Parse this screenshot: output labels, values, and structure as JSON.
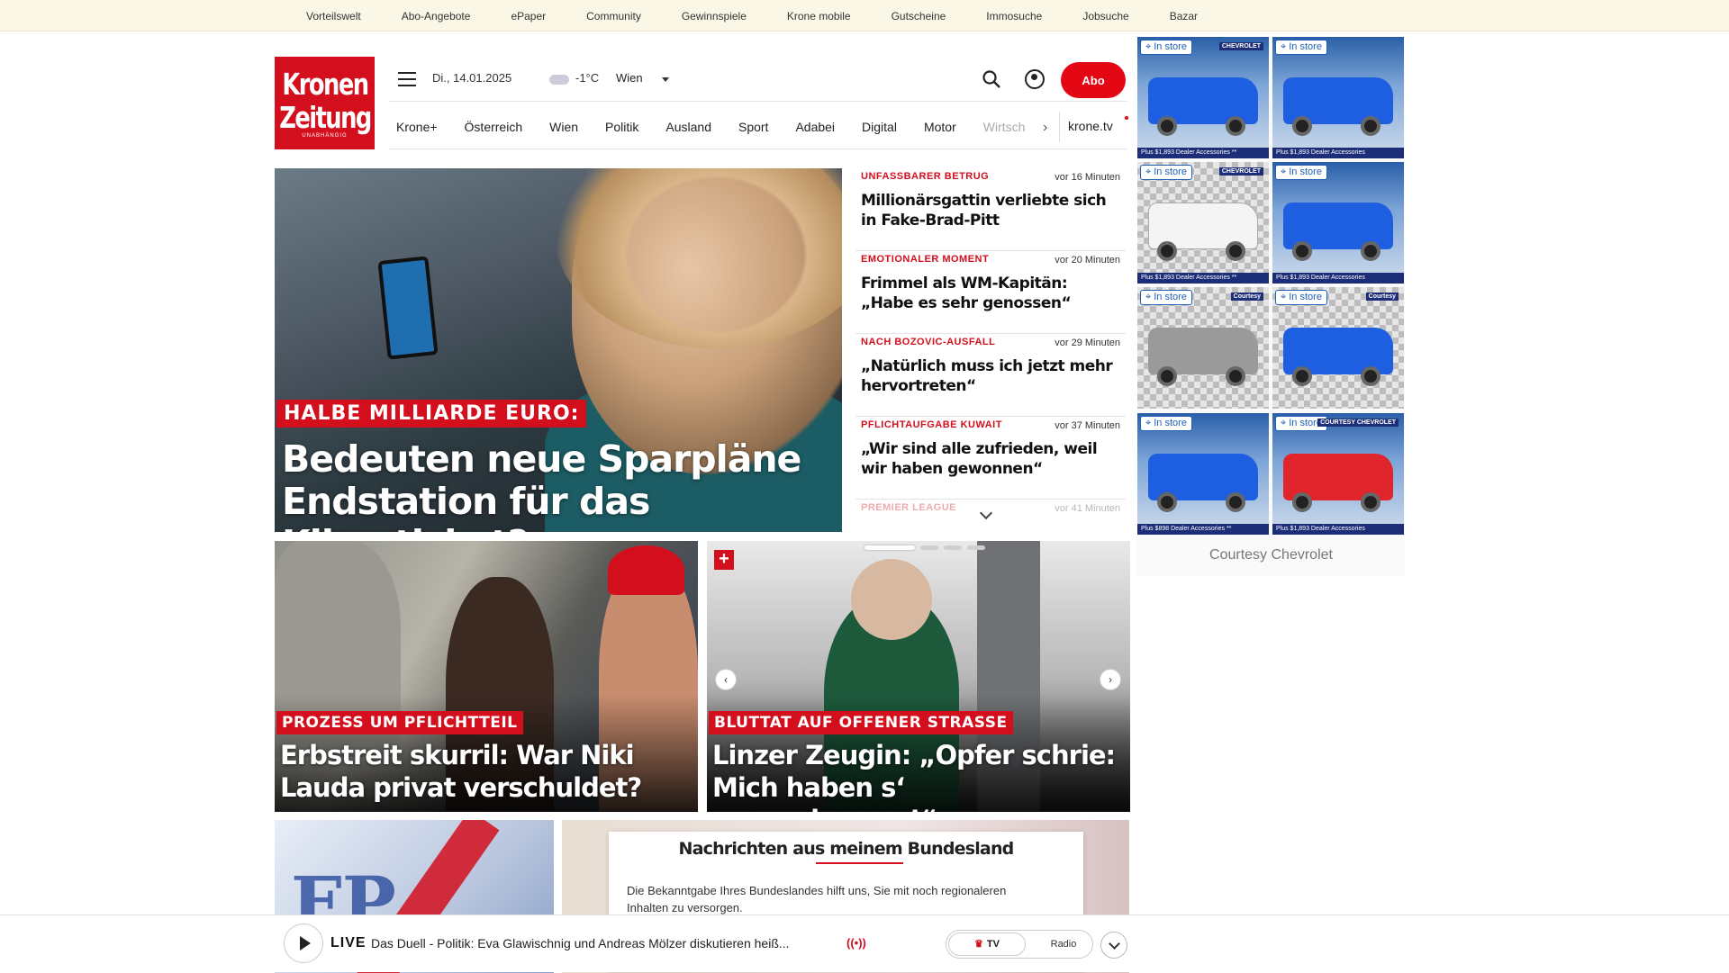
{
  "topbar": {
    "links": [
      "Vorteilswelt",
      "Abo-Angebote",
      "ePaper",
      "Community",
      "Gewinnspiele",
      "Krone mobile",
      "Gutscheine",
      "Immosuche",
      "Jobsuche",
      "Bazar"
    ]
  },
  "logo": {
    "line1": "Kronen",
    "line2": "Zeitung",
    "tagline": "UNABHÄNGIG"
  },
  "header": {
    "date": "Di., 14.01.2025",
    "weather_icon": "cloud-icon",
    "temperature": "-1°C",
    "city": "Wien",
    "abo_label": "Abo"
  },
  "nav": {
    "items": [
      "Krone+",
      "Österreich",
      "Wien",
      "Politik",
      "Ausland",
      "Sport",
      "Adabei",
      "Digital",
      "Motor",
      "Wirtsch"
    ],
    "krone_tv": "krone.tv"
  },
  "hero": {
    "kicker": "HALBE MILLIARDE EURO:",
    "headline": "Bedeuten neue Sparpläne Endstation für das Klimaticket?"
  },
  "ticker": [
    {
      "kicker": "UNFASSBARER BETRUG",
      "time": "vor 16 Minuten",
      "title": "Millionärsgattin verliebte sich in Fake-Brad-Pitt"
    },
    {
      "kicker": "EMOTIONALER MOMENT",
      "time": "vor 20 Minuten",
      "title": "Frimmel als WM-Kapitän: „Habe es sehr genossen“"
    },
    {
      "kicker": "NACH BOZOVIC-AUSFALL",
      "time": "vor 29 Minuten",
      "title": "„Natürlich muss ich jetzt mehr hervortreten“"
    },
    {
      "kicker": "PFLICHTAUFGABE KUWAIT",
      "time": "vor 37 Minuten",
      "title": "„Wir sind alle zufrieden, weil wir haben gewonnen“"
    },
    {
      "kicker": "PREMIER LEAGUE",
      "time": "vor 41 Minuten",
      "title": ""
    }
  ],
  "cards": [
    {
      "kicker": "PROZESS UM PFLICHTTEIL",
      "headline": "Erbstreit skurril: War Niki Lauda privat verschuldet?"
    },
    {
      "kicker": "BLUTTAT AUF OFFENER STRASSE",
      "headline": "Linzer Zeugin: „Opfer schrie: Mich haben s‘ angeschossen!“"
    }
  ],
  "bundesland": {
    "title": "Nachrichten aus meinem Bundesland",
    "description": "Die Bekanntgabe Ihres Bundeslandes hilft uns, Sie mit noch regionaleren Inhalten zu versorgen."
  },
  "ad": {
    "pill": "In store",
    "tiles": [
      {
        "brand": "CHEVROLET",
        "footer": "Plus $1,893 Dealer Accessories **",
        "color": "blue"
      },
      {
        "brand": "",
        "footer": "Plus $1,893 Dealer Accessories",
        "color": "blue"
      },
      {
        "brand": "CHEVROLET",
        "footer": "Plus $1,893 Dealer Accessories **",
        "color": "white"
      },
      {
        "brand": "",
        "footer": "Plus $1,893 Dealer Accessories",
        "color": "blue"
      },
      {
        "brand": "Courtesy",
        "footer": "",
        "color": "silver"
      },
      {
        "brand": "Courtesy",
        "footer": "",
        "color": "blue"
      },
      {
        "brand": "",
        "footer": "Plus $898 Dealer Accessories **",
        "color": "blue"
      },
      {
        "brand": "COURTESY CHEVROLET",
        "footer": "Plus $1,893 Dealer Accessories",
        "color": "red"
      }
    ],
    "credit": "Courtesy Chevrolet"
  },
  "player": {
    "live_label": "LIVE",
    "title": "Das Duell - Politik: Eva Glawischnig und Andreas Mölzer diskutieren heiß...",
    "tv_label": "TV",
    "radio_label": "Radio"
  },
  "colors": {
    "brand_red": "#d40f1d",
    "abo_red": "#e30613",
    "topbar_bg": "#fbf7e6"
  }
}
